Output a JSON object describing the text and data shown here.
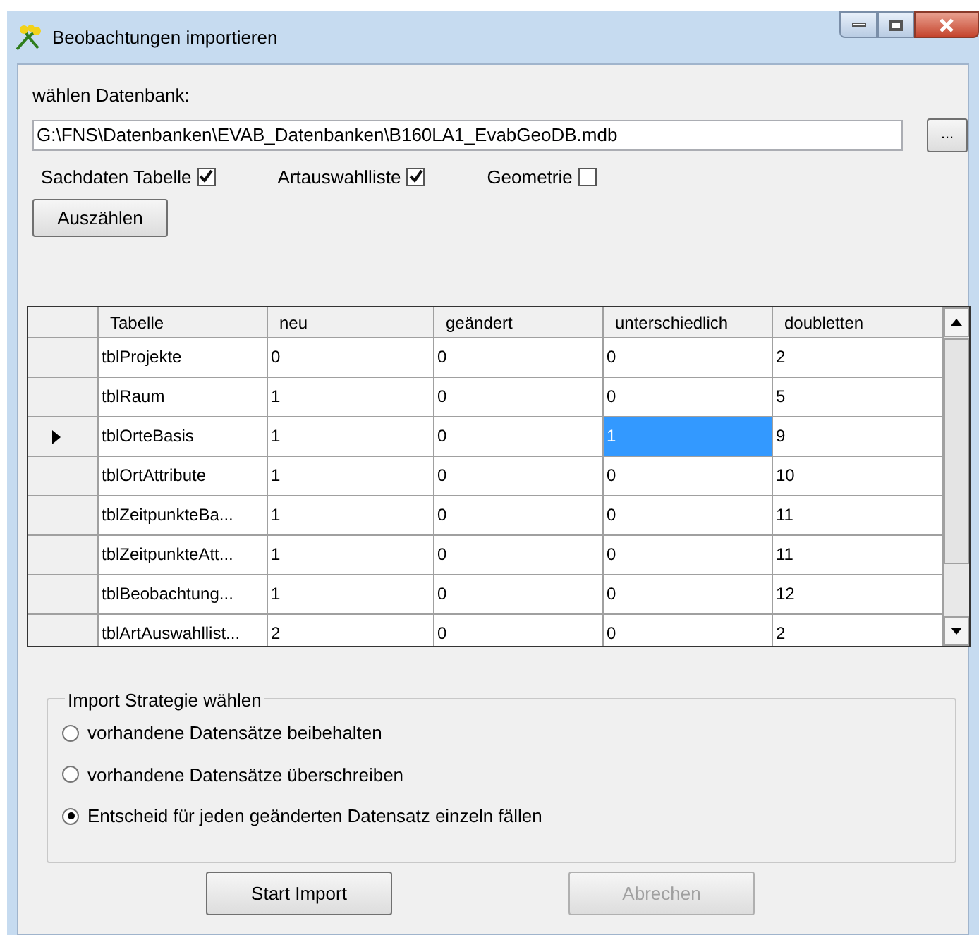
{
  "window": {
    "title": "Beobachtungen importieren"
  },
  "database": {
    "label": "wählen Datenbank:",
    "value": "G:\\FNS\\Datenbanken\\EVAB_Datenbanken\\B160LA1_EvabGeoDB.mdb",
    "browse": "..."
  },
  "options": [
    {
      "label": "Sachdaten Tabelle",
      "checked": true
    },
    {
      "label": "Artauswahlliste",
      "checked": true
    },
    {
      "label": "Geometrie",
      "checked": false
    }
  ],
  "count_button": {
    "label": "Auszählen"
  },
  "table": {
    "columns": [
      "Tabelle",
      "neu",
      "geändert",
      "unterschiedlich",
      "doubletten"
    ],
    "rows": [
      {
        "current": false,
        "cells": [
          {
            "text": "tblProjekte",
            "selected": false
          },
          {
            "text": "0",
            "selected": false
          },
          {
            "text": "0",
            "selected": false
          },
          {
            "text": "0",
            "selected": false
          },
          {
            "text": "2",
            "selected": false
          }
        ]
      },
      {
        "current": false,
        "cells": [
          {
            "text": "tblRaum",
            "selected": false
          },
          {
            "text": "1",
            "selected": false
          },
          {
            "text": "0",
            "selected": false
          },
          {
            "text": "0",
            "selected": false
          },
          {
            "text": "5",
            "selected": false
          }
        ]
      },
      {
        "current": true,
        "cells": [
          {
            "text": "tblOrteBasis",
            "selected": false
          },
          {
            "text": "1",
            "selected": false
          },
          {
            "text": "0",
            "selected": false
          },
          {
            "text": "1",
            "selected": true
          },
          {
            "text": "9",
            "selected": false
          }
        ]
      },
      {
        "current": false,
        "cells": [
          {
            "text": "tblOrtAttribute",
            "selected": false
          },
          {
            "text": "1",
            "selected": false
          },
          {
            "text": "0",
            "selected": false
          },
          {
            "text": "0",
            "selected": false
          },
          {
            "text": "10",
            "selected": false
          }
        ]
      },
      {
        "current": false,
        "cells": [
          {
            "text": "tblZeitpunkteBa...",
            "selected": false
          },
          {
            "text": "1",
            "selected": false
          },
          {
            "text": "0",
            "selected": false
          },
          {
            "text": "0",
            "selected": false
          },
          {
            "text": "11",
            "selected": false
          }
        ]
      },
      {
        "current": false,
        "cells": [
          {
            "text": "tblZeitpunkteAtt...",
            "selected": false
          },
          {
            "text": "1",
            "selected": false
          },
          {
            "text": "0",
            "selected": false
          },
          {
            "text": "0",
            "selected": false
          },
          {
            "text": "11",
            "selected": false
          }
        ]
      },
      {
        "current": false,
        "cells": [
          {
            "text": "tblBeobachtung...",
            "selected": false
          },
          {
            "text": "1",
            "selected": false
          },
          {
            "text": "0",
            "selected": false
          },
          {
            "text": "0",
            "selected": false
          },
          {
            "text": "12",
            "selected": false
          }
        ]
      },
      {
        "current": false,
        "cells": [
          {
            "text": "tblArtAuswahllist...",
            "selected": false
          },
          {
            "text": "2",
            "selected": false
          },
          {
            "text": "0",
            "selected": false
          },
          {
            "text": "0",
            "selected": false
          },
          {
            "text": "2",
            "selected": false
          }
        ]
      }
    ]
  },
  "strategy": {
    "title": "Import Strategie wählen",
    "choices": [
      {
        "label": "vorhandene Datensätze beibehalten",
        "selected": false
      },
      {
        "label": "vorhandene Datensätze überschreiben",
        "selected": false
      },
      {
        "label": "Entscheid für jeden geänderten Datensatz einzeln fällen",
        "selected": true
      }
    ]
  },
  "buttons": [
    {
      "label": "Start Import",
      "disabled": false
    },
    {
      "label": "Abrechen",
      "disabled": true
    }
  ]
}
